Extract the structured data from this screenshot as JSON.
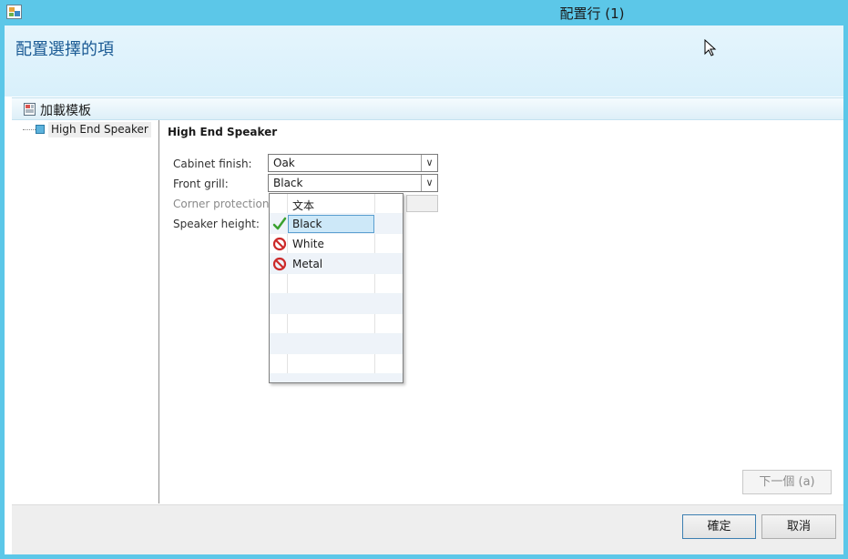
{
  "window": {
    "title": "配置行 (1)"
  },
  "header": {
    "title": "配置選擇的項"
  },
  "toolbar": {
    "load_template_label": "加載模板"
  },
  "tree": {
    "root_label": "High End Speaker"
  },
  "form": {
    "section_title": "High End Speaker",
    "fields": [
      {
        "label": "Cabinet finish:",
        "value": "Oak"
      },
      {
        "label": "Front grill:",
        "value": "Black"
      },
      {
        "label": "Corner protection:",
        "value": ""
      },
      {
        "label": "Speaker height:",
        "value": ""
      }
    ]
  },
  "dropdown": {
    "header_label": "文本",
    "options": [
      {
        "label": "Black",
        "status": "valid",
        "icon": "check-icon",
        "selected": true
      },
      {
        "label": "White",
        "status": "invalid",
        "icon": "blocked-icon",
        "selected": false
      },
      {
        "label": "Metal",
        "status": "invalid",
        "icon": "blocked-icon",
        "selected": false
      }
    ]
  },
  "buttons": {
    "next": "下一個 (a)",
    "ok": "確定",
    "cancel": "取消"
  },
  "colors": {
    "title_bar": "#5cc7e8",
    "header_text": "#1a5a94",
    "selection": "#cde8f8",
    "valid_icon": "#3aa12f",
    "invalid_icon": "#cc2a2a"
  }
}
